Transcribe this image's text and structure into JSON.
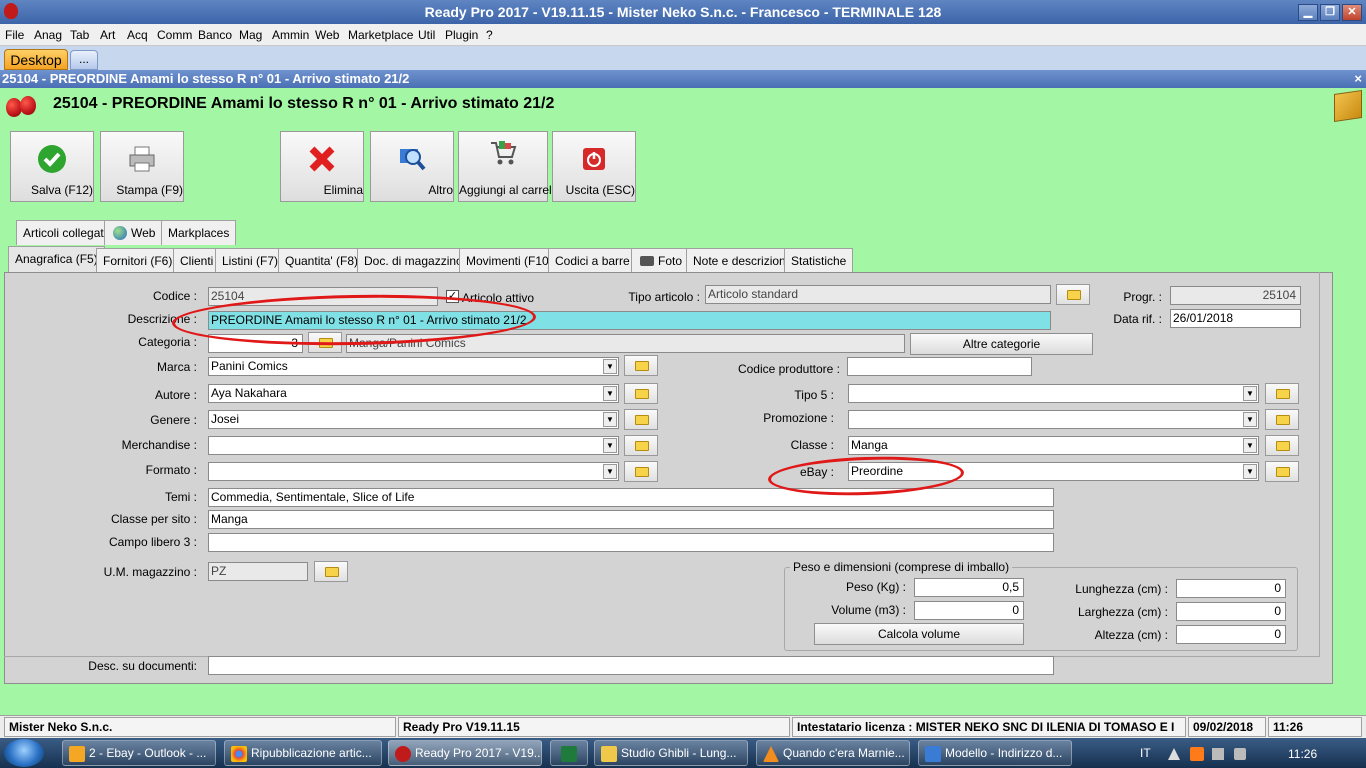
{
  "window": {
    "title": "Ready Pro 2017 - V19.11.15 - Mister Neko S.n.c. - Francesco - TERMINALE 128",
    "min": "▁",
    "max": "❐",
    "close": "✕"
  },
  "menu": [
    "File",
    "Anag",
    "Tab",
    "Art",
    "Acq",
    "Comm",
    "Banco",
    "Mag",
    "Ammin",
    "Web",
    "Marketplace",
    "Util",
    "Plugin",
    "?"
  ],
  "tabs": {
    "desktop": "Desktop",
    "more": "..."
  },
  "doc": {
    "bar_title": "25104 - PREORDINE Amami lo stesso R n° 01 - Arrivo stimato 21/2",
    "close": "×",
    "heading": "25104 - PREORDINE Amami lo stesso R n° 01 - Arrivo stimato 21/2"
  },
  "toolbar": {
    "save": "Salva (F12)",
    "print": "Stampa (F9)",
    "delete": "Elimina",
    "other": "Altro",
    "cart": "Aggiungi al carrello",
    "exit": "Uscita (ESC)"
  },
  "tabs_row1": [
    "Articoli collegati",
    "Web",
    "Markplaces"
  ],
  "tabs_row2": [
    "Anagrafica (F5)",
    "Fornitori (F6)",
    "Clienti",
    "Listini (F7)",
    "Quantita' (F8)",
    "Doc. di magazzino",
    "Movimenti (F10)",
    "Codici a barre",
    "Foto",
    "Note e descrizioni",
    "Statistiche"
  ],
  "form": {
    "codice_label": "Codice :",
    "codice": "25104",
    "attivo_label": "Articolo attivo",
    "attivo_check": "✓",
    "tipo_label": "Tipo articolo :",
    "tipo": "Articolo standard",
    "progr_label": "Progr. :",
    "progr": "25104",
    "descr_label": "Descrizione :",
    "descr": "PREORDINE Amami lo stesso R n° 01 - Arrivo stimato 21/2",
    "datarif_label": "Data rif. :",
    "datarif": "26/01/2018",
    "categoria_label": "Categoria :",
    "categoria_code": "3",
    "categoria": "Manga/Panini Comics",
    "altre_cat": "Altre categorie",
    "marca_label": "Marca :",
    "marca": "Panini Comics",
    "codprod_label": "Codice produttore :",
    "codprod": "",
    "autore_label": "Autore :",
    "autore": "Aya Nakahara",
    "tipo5_label": "Tipo 5 :",
    "tipo5": "",
    "genere_label": "Genere :",
    "genere": "Josei",
    "promo_label": "Promozione :",
    "promo": "",
    "merch_label": "Merchandise :",
    "merch": "",
    "classe_label": "Classe :",
    "classe": "Manga",
    "formato_label": "Formato :",
    "formato": "",
    "ebay_label": "eBay :",
    "ebay": "Preordine",
    "temi_label": "Temi :",
    "temi": "Commedia, Sentimentale, Slice of Life",
    "classesito_label": "Classe per sito :",
    "classesito": "Manga",
    "campo3_label": "Campo libero 3 :",
    "campo3": "",
    "um_label": "U.M. magazzino :",
    "um": "PZ",
    "desc_doc_label": "Desc. su documenti:",
    "desc_doc": ""
  },
  "peso": {
    "title": "Peso e dimensioni (comprese di imballo)",
    "peso_label": "Peso (Kg) :",
    "peso": "0,5",
    "vol_label": "Volume (m3) :",
    "vol": "0",
    "calc": "Calcola volume",
    "lung_label": "Lunghezza (cm) :",
    "lung": "0",
    "larg_label": "Larghezza (cm) :",
    "larg": "0",
    "alt_label": "Altezza (cm) :",
    "alt": "0"
  },
  "status": {
    "company": "Mister Neko S.n.c.",
    "version": "Ready Pro V19.11.15",
    "license": "Intestatario licenza : MISTER NEKO SNC DI ILENIA DI TOMASO E I",
    "date": "09/02/2018",
    "time": "11:26"
  },
  "taskbar": {
    "items": [
      "2 - Ebay - Outlook - ...",
      "Ripubblicazione artic...",
      "Ready Pro 2017 - V19...",
      "",
      "Studio Ghibli - Lung...",
      "Quando c'era Marnie...",
      "Modello - Indirizzo d..."
    ],
    "lang": "IT",
    "clock": "11:26"
  },
  "colors": {
    "bg": "#a3f6a3",
    "highlight": "#7fe1e6",
    "annotation": "#e01818"
  }
}
